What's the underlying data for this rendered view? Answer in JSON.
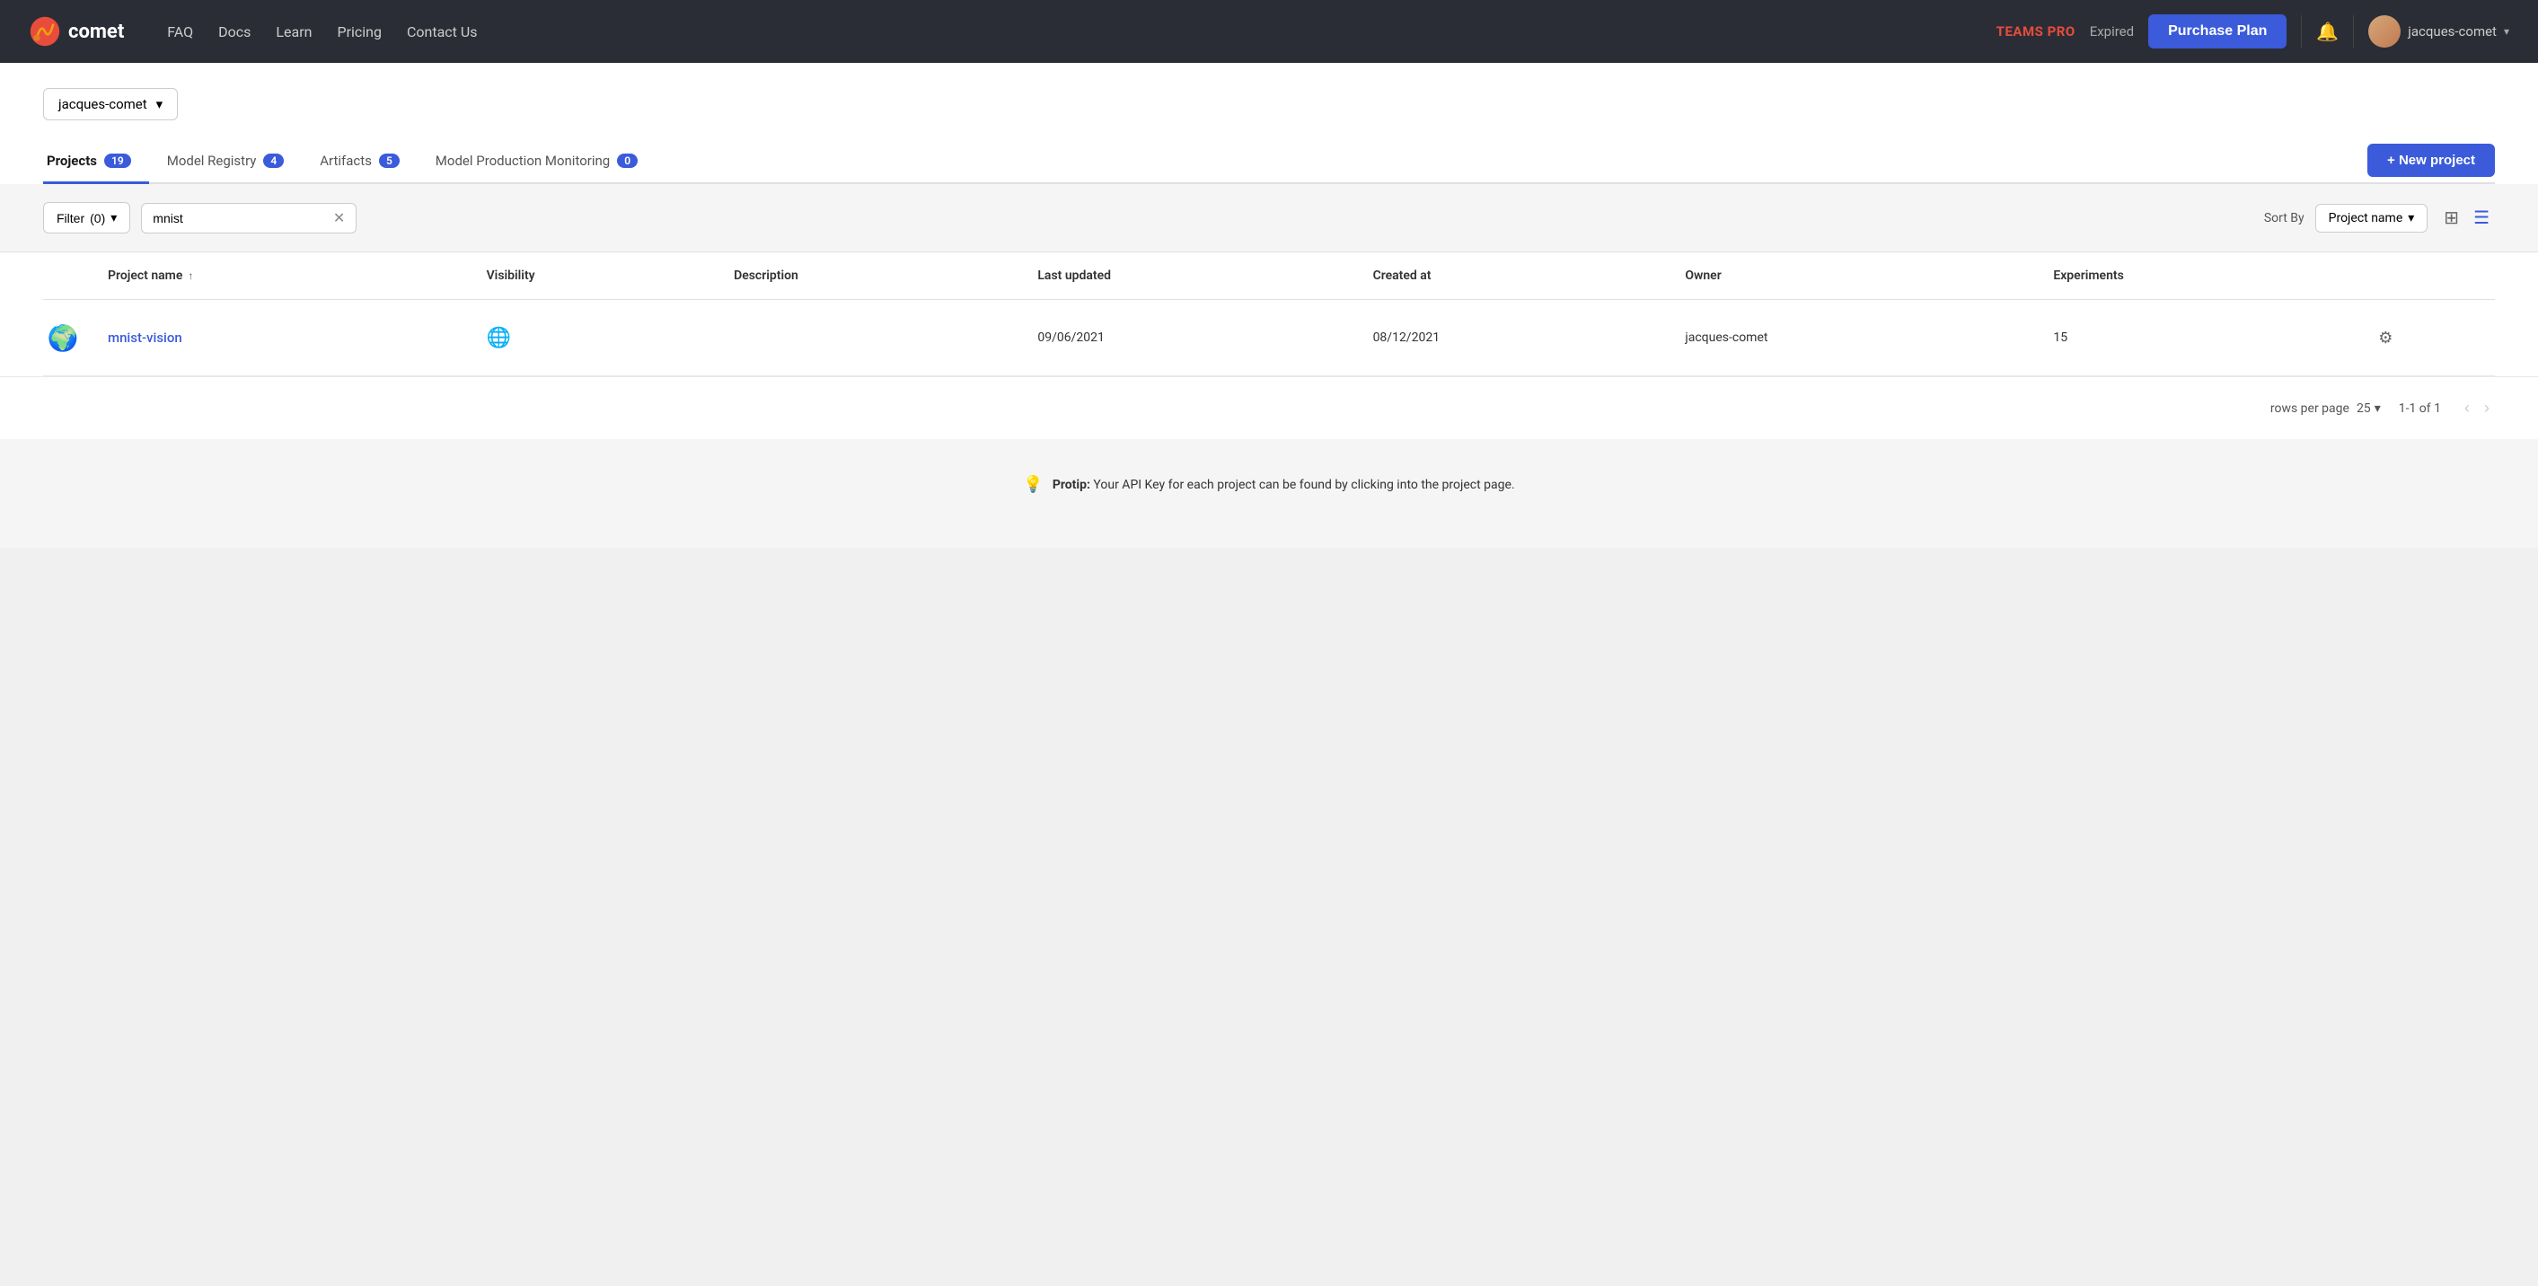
{
  "navbar": {
    "logo_text": "comet",
    "links": [
      {
        "label": "FAQ",
        "id": "faq"
      },
      {
        "label": "Docs",
        "id": "docs"
      },
      {
        "label": "Learn",
        "id": "learn"
      },
      {
        "label": "Pricing",
        "id": "pricing"
      },
      {
        "label": "Contact Us",
        "id": "contact"
      }
    ],
    "plan_label": "TEAMS PRO",
    "expired_label": "Expired",
    "purchase_label": "Purchase Plan",
    "username": "jacques-comet"
  },
  "workspace": {
    "name": "jacques-comet"
  },
  "tabs": [
    {
      "label": "Projects",
      "badge": "19",
      "active": true,
      "id": "projects"
    },
    {
      "label": "Model Registry",
      "badge": "4",
      "active": false,
      "id": "model-registry"
    },
    {
      "label": "Artifacts",
      "badge": "5",
      "active": false,
      "id": "artifacts"
    },
    {
      "label": "Model Production Monitoring",
      "badge": "0",
      "active": false,
      "id": "mpm"
    }
  ],
  "new_project_btn": "+ New project",
  "filter": {
    "label": "Filter",
    "count": "(0)",
    "search_value": "mnist",
    "search_placeholder": "Search projects..."
  },
  "sort": {
    "label": "Sort By",
    "value": "Project name"
  },
  "table": {
    "columns": [
      "Project name",
      "Visibility",
      "Description",
      "Last updated",
      "Created at",
      "Owner",
      "Experiments"
    ],
    "rows": [
      {
        "name": "mnist-vision",
        "visibility_icon": "🌐",
        "description": "",
        "last_updated": "09/06/2021",
        "created_at": "08/12/2021",
        "owner": "jacques-comet",
        "experiments": "15"
      }
    ]
  },
  "pagination": {
    "rows_per_page_label": "rows per page",
    "rows_per_page_value": "25",
    "page_info": "1-1 of 1"
  },
  "protip": {
    "icon": "💡",
    "bold": "Protip:",
    "text": " Your API Key for each project can be found by clicking into the project page."
  }
}
